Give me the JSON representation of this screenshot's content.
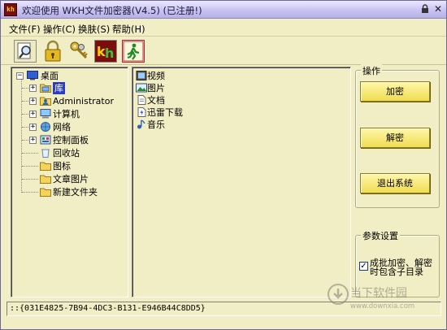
{
  "window": {
    "title": "欢迎使用 WKH文件加密器(V4.5)  (已注册!)",
    "app_icon_text": "kh",
    "controls": {
      "lock_glyph": "🔒",
      "close_glyph": "✕"
    }
  },
  "menu": [
    {
      "label": "文件(F)"
    },
    {
      "label": "操作(C)"
    },
    {
      "label": "换肤(S)"
    },
    {
      "label": "帮助(H)"
    }
  ],
  "toolbar": [
    {
      "icon": "search-icon"
    },
    {
      "icon": "lock-icon"
    },
    {
      "icon": "keys-icon"
    },
    {
      "icon": "kh-logo-icon"
    },
    {
      "icon": "exit-icon"
    }
  ],
  "tree": {
    "root": {
      "label": "桌面",
      "icon": "desktop-icon",
      "expander": "−"
    },
    "items": [
      {
        "label": "库",
        "icon": "library-icon",
        "expander": "+",
        "selected": true
      },
      {
        "label": "Administrator",
        "icon": "user-folder-icon",
        "expander": "+"
      },
      {
        "label": "计算机",
        "icon": "computer-icon",
        "expander": "+"
      },
      {
        "label": "网络",
        "icon": "network-icon",
        "expander": "+"
      },
      {
        "label": "控制面板",
        "icon": "control-panel-icon",
        "expander": "+"
      },
      {
        "label": "回收站",
        "icon": "recycle-bin-icon"
      },
      {
        "label": "图标",
        "icon": "folder-icon"
      },
      {
        "label": "文章图片",
        "icon": "folder-icon"
      },
      {
        "label": "新建文件夹",
        "icon": "folder-icon"
      }
    ]
  },
  "files": [
    {
      "label": "视频",
      "icon": "video-icon"
    },
    {
      "label": "图片",
      "icon": "picture-icon"
    },
    {
      "label": "文档",
      "icon": "document-icon"
    },
    {
      "label": "迅雷下载",
      "icon": "download-icon"
    },
    {
      "label": "音乐",
      "icon": "music-icon"
    }
  ],
  "operations": {
    "legend": "操作",
    "encrypt": "加密",
    "decrypt": "解密",
    "exit": "退出系统"
  },
  "params": {
    "legend": "参数设置",
    "checkbox_checked": true,
    "checkbox_mark": "✓",
    "checkbox_label": "成批加密、解密时包含子目录"
  },
  "status": "::{031E4825-7B94-4DC3-B131-E946B44C8DD5}",
  "watermark": {
    "text": "当下软件园",
    "url": "www.downxia.com"
  },
  "colors": {
    "window_bg": "#f1eec5",
    "selection": "#2b3ec1",
    "button_face": "#f0dc52",
    "titlebar": "#c9c3f2"
  }
}
